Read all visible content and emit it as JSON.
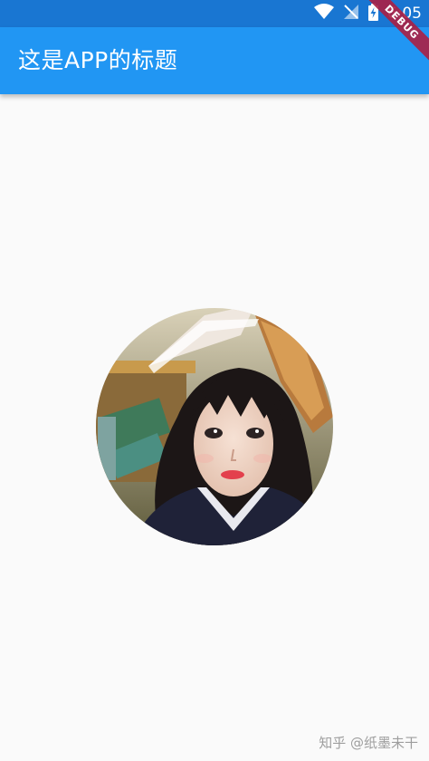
{
  "status_bar": {
    "time": "6:05",
    "icons": [
      "wifi-icon",
      "signal-off-icon",
      "battery-charging-icon"
    ]
  },
  "app_bar": {
    "title": "这是APP的标题"
  },
  "debug_banner": {
    "label": "DEBUG"
  },
  "content": {
    "avatar_image": "circular-photo-girl-with-book-on-head"
  },
  "watermark": {
    "text": "知乎 @纸墨未干"
  },
  "colors": {
    "status_bar": "#1976d2",
    "app_bar": "#2196f3",
    "background": "#fafafa",
    "debug_banner": "#ac1f42"
  }
}
